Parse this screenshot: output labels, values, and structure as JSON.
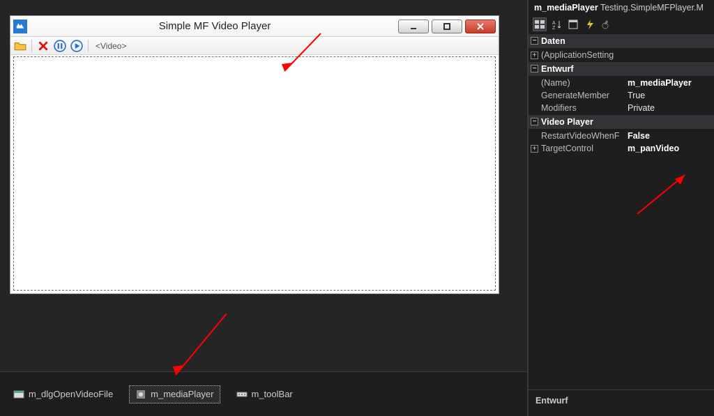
{
  "header": {
    "object_name": "m_mediaPlayer",
    "object_type": "Testing.SimpleMFPlayer.M"
  },
  "window": {
    "title": "Simple MF Video Player",
    "toolbar": {
      "open_icon": "folder-open-icon",
      "stop_icon": "x-red-icon",
      "pause_icon": "pause-icon",
      "play_icon": "play-icon",
      "video_label": "<Video>"
    }
  },
  "component_tray": {
    "items": [
      {
        "label": "m_dlgOpenVideoFile",
        "icon": "dialog-icon",
        "selected": false
      },
      {
        "label": "m_mediaPlayer",
        "icon": "component-icon",
        "selected": true
      },
      {
        "label": "m_toolBar",
        "icon": "toolbar-icon",
        "selected": false
      }
    ]
  },
  "properties": {
    "categories": [
      {
        "name": "Daten",
        "expanded": true,
        "rows": [
          {
            "name": "(ApplicationSetting",
            "value": "",
            "expander": "plus"
          }
        ]
      },
      {
        "name": "Entwurf",
        "expanded": true,
        "rows": [
          {
            "name": "(Name)",
            "value": "m_mediaPlayer",
            "bold": true
          },
          {
            "name": "GenerateMember",
            "value": "True"
          },
          {
            "name": "Modifiers",
            "value": "Private"
          }
        ]
      },
      {
        "name": "Video Player",
        "expanded": true,
        "rows": [
          {
            "name": "RestartVideoWhenF",
            "value": "False",
            "bold": true
          },
          {
            "name": "TargetControl",
            "value": "m_panVideo",
            "bold": true,
            "expander": "plus"
          }
        ]
      }
    ],
    "description_title": "Entwurf"
  }
}
